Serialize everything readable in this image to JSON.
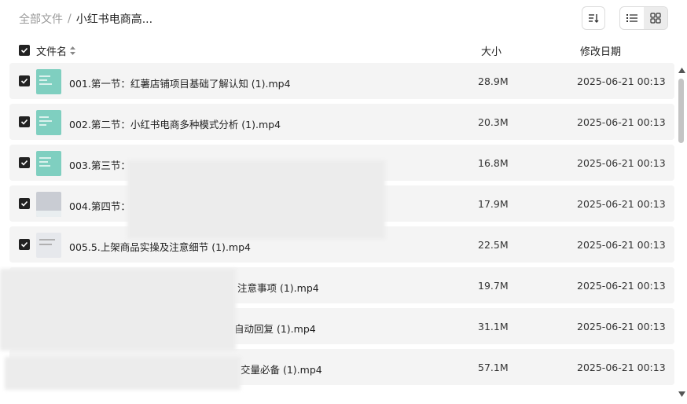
{
  "breadcrumb": {
    "root": "全部文件",
    "separator": "/",
    "current": "小红书电商高..."
  },
  "header": {
    "name": "文件名",
    "size": "大小",
    "date": "修改日期"
  },
  "files": [
    {
      "name": "001.第一节：红薯店铺项目基础了解认知 (1).mp4",
      "size": "28.9M",
      "date": "2025-06-21 00:13"
    },
    {
      "name": "002.第二节：小红书电商多种模式分析 (1).mp4",
      "size": "20.3M",
      "date": "2025-06-21 00:13"
    },
    {
      "name": "003.第三节：",
      "size": "16.8M",
      "date": "2025-06-21 00:13"
    },
    {
      "name": "004.第四节：",
      "size": "17.9M",
      "date": "2025-06-21 00:13"
    },
    {
      "name": "005.5.上架商品实操及注意细节 (1).mp4",
      "size": "22.5M",
      "date": "2025-06-21 00:13"
    },
    {
      "name": "注意事项 (1).mp4",
      "size": "19.7M",
      "date": "2025-06-21 00:13"
    },
    {
      "name": "自动回复 (1).mp4",
      "size": "31.1M",
      "date": "2025-06-21 00:13"
    },
    {
      "name": "交量必备 (1).mp4",
      "size": "57.1M",
      "date": "2025-06-21 00:13"
    }
  ],
  "icons": {
    "sort": "sort-icon",
    "list_view": "list-view-icon",
    "grid_view": "grid-view-icon",
    "sort_name": "sort-arrows-icon",
    "checkbox": "checkmark-icon",
    "scroll_up": "scroll-up-arrow-icon",
    "scroll_down": "scroll-down-arrow-icon"
  }
}
